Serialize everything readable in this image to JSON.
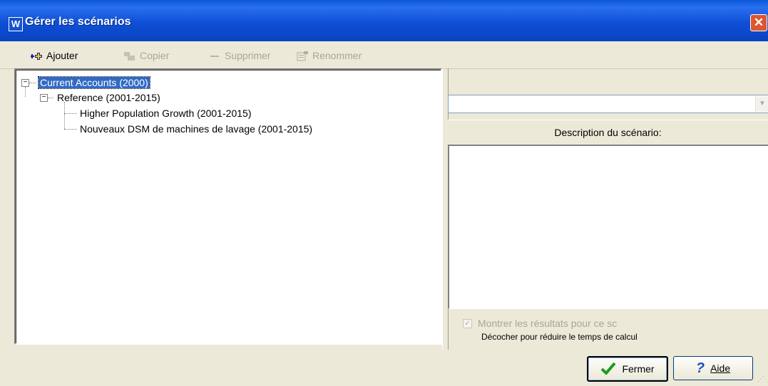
{
  "window": {
    "title": "Gérer les scénarios",
    "app_icon_letter": "W",
    "close_glyph": "✕"
  },
  "toolbar": {
    "add": {
      "label": "Ajouter",
      "icon": "add-icon",
      "enabled": true
    },
    "copy": {
      "label": "Copier",
      "icon": "copy-icon",
      "enabled": false
    },
    "delete": {
      "label": "Supprimer",
      "icon": "minus-icon",
      "enabled": false
    },
    "rename": {
      "label": "Renommer",
      "icon": "rename-icon",
      "enabled": false
    }
  },
  "tree": {
    "root": {
      "label": "Current Accounts (2000)",
      "expanded": true,
      "selected": true
    },
    "reference": {
      "label": "Reference (2001-2015)",
      "expanded": true
    },
    "children": [
      {
        "label": "Higher Population Growth (2001-2015)"
      },
      {
        "label": "Nouveaux DSM de machines de lavage (2001-2015)"
      }
    ]
  },
  "right_panel": {
    "combo_value": "",
    "description_header": "Description du scénario:",
    "description_text": ""
  },
  "options": {
    "show_results_label": "Montrer les résultats pour ce sc",
    "show_results_checked": true,
    "hint": "Décocher pour réduire le temps de calcul"
  },
  "buttons": {
    "close": "Fermer",
    "help": "Aide"
  },
  "colors": {
    "titlebar": "#0a58d8",
    "selection": "#316ac5",
    "dialog_bg": "#ece9d8"
  }
}
